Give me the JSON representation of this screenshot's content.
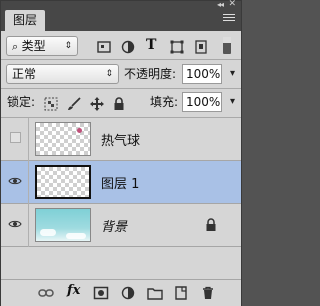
{
  "panel": {
    "collapse_glyph": "◂◂",
    "close_glyph": "✕",
    "tab_label": "图层"
  },
  "filter": {
    "kind_label": "类型",
    "kind_prefix_icon": "search-icon",
    "filter_icons": [
      "pixel-filter-icon",
      "adjustment-filter-icon",
      "type-filter-icon",
      "shape-filter-icon",
      "smart-object-filter-icon"
    ]
  },
  "blend": {
    "mode": "正常",
    "opacity_label": "不透明度:",
    "opacity_value": "100%"
  },
  "lock_row": {
    "lock_label": "锁定:",
    "fill_label": "填充:",
    "fill_value": "100%"
  },
  "layers": [
    {
      "name": "热气球",
      "visible": false,
      "selected": false,
      "thumb": "transparent"
    },
    {
      "name": "图层 1",
      "visible": true,
      "selected": true,
      "thumb": "transparent"
    },
    {
      "name": "背景",
      "visible": true,
      "selected": false,
      "thumb": "sky",
      "locked": true,
      "italic": true
    }
  ],
  "bottom_icons": [
    "link-layers-icon",
    "fx-icon",
    "add-mask-icon",
    "adjustment-layer-icon",
    "new-group-icon",
    "new-layer-icon",
    "delete-icon"
  ],
  "bottom_fx_label": "fx",
  "colors": {
    "selection": "#a9c1e6",
    "panel_bg": "#d6d6d6",
    "header_bg": "#474747"
  }
}
